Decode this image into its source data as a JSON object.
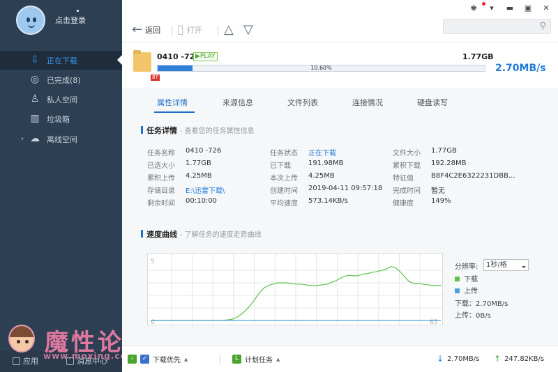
{
  "user": {
    "login_label": "点击登录"
  },
  "sidebar": {
    "items": [
      {
        "label": "正在下载",
        "icon": "download-icon"
      },
      {
        "label": "已完成(8)",
        "icon": "check-circle-icon"
      },
      {
        "label": "私人空间",
        "icon": "user-icon"
      },
      {
        "label": "垃圾箱",
        "icon": "trash-icon"
      },
      {
        "label": "离线空间",
        "icon": "cloud-icon"
      }
    ],
    "apps_label": "应用",
    "messages_label": "消息中心"
  },
  "watermark": {
    "text": "魔性论坛",
    "url": "www.moxing.com"
  },
  "toolbar": {
    "back_label": "返回",
    "open_label": "打开"
  },
  "task": {
    "name": "0410 -726",
    "play_label": "PLAY",
    "type_tag": "BT",
    "size": "1.77GB",
    "progress_text": "10.60%",
    "progress": 0.106,
    "speed": "2.70MB/s"
  },
  "tabs": [
    {
      "label": "属性详情"
    },
    {
      "label": "来源信息"
    },
    {
      "label": "文件列表"
    },
    {
      "label": "连接情况"
    },
    {
      "label": "硬盘读写"
    }
  ],
  "details": {
    "title": "任务详情",
    "subtitle": "- 查看您的任务属性信息",
    "fields": [
      {
        "k": "任务名称",
        "v": "0410 -726"
      },
      {
        "k": "已选大小",
        "v": "1.77GB"
      },
      {
        "k": "累积上传",
        "v": "4.25MB"
      },
      {
        "k": "存储目录",
        "v": "E:\\迅雷下载\\"
      },
      {
        "k": "剩余时间",
        "v": "00:10:00"
      },
      {
        "k": "任务状态",
        "v": "正在下载"
      },
      {
        "k": "已下载",
        "v": "191.98MB"
      },
      {
        "k": "本次上传",
        "v": "4.25MB"
      },
      {
        "k": "创建时间",
        "v": "2019-04-11 09:57:18"
      },
      {
        "k": "平均速度",
        "v": "573.14KB/s"
      },
      {
        "k": "文件大小",
        "v": "1.77GB"
      },
      {
        "k": "累积下载",
        "v": "192.28MB"
      },
      {
        "k": "特征值",
        "v": "B8F4C2E6322231DBB..."
      },
      {
        "k": "完成时间",
        "v": "暂无"
      },
      {
        "k": "健康度",
        "v": "149%"
      }
    ]
  },
  "speed_section": {
    "title": "速度曲线",
    "subtitle": "- 了解任务的速度走势曲线",
    "rate_label": "分辨率:",
    "rate_value": "1秒/格",
    "download_legend": "下载",
    "upload_legend": "上传",
    "download_speed_text": "下载：2.70MB/s",
    "upload_speed_text": "上传：0B/s",
    "download_color": "#5ec24a",
    "upload_color": "#4aa3df"
  },
  "chart_data": {
    "type": "line",
    "ylim": [
      0,
      5
    ],
    "y_tick_labels": [
      "5",
      "0"
    ],
    "x_end_label": "65",
    "series": [
      {
        "name": "下载",
        "values": [
          0,
          0,
          0,
          0,
          0,
          0,
          0,
          0,
          0,
          0,
          0,
          0,
          0,
          0,
          0,
          0,
          0,
          0.05,
          0.1,
          0.25,
          0.5,
          0.8,
          1.2,
          1.7,
          2.2,
          2.6,
          2.8,
          2.9,
          3.0,
          3.0,
          3.0,
          2.95,
          2.9,
          2.9,
          2.85,
          2.8,
          2.75,
          2.8,
          2.85,
          2.9,
          3.05,
          3.2,
          3.4,
          3.55,
          3.6,
          3.55,
          3.6,
          3.7,
          3.75,
          3.85,
          3.9,
          4.0,
          4.1,
          4.3,
          4.2,
          3.9,
          3.5,
          3.1,
          2.95,
          2.95,
          2.9,
          2.85,
          2.8,
          2.8,
          2.8
        ]
      },
      {
        "name": "上传",
        "values": [
          0,
          0,
          0,
          0,
          0,
          0,
          0,
          0,
          0,
          0,
          0,
          0,
          0,
          0,
          0,
          0,
          0,
          0,
          0,
          0,
          0,
          0,
          0,
          0,
          0,
          0,
          0,
          0,
          0,
          0,
          0,
          0,
          0,
          0,
          0,
          0,
          0,
          0,
          0,
          0,
          0,
          0,
          0,
          0,
          0,
          0,
          0,
          0,
          0,
          0,
          0,
          0,
          0,
          0,
          0,
          0,
          0,
          0,
          0,
          0,
          0,
          0,
          0,
          0,
          0
        ]
      }
    ],
    "grid": true
  },
  "statusbar": {
    "priority_label": "下载优先",
    "schedule_label": "计划任务",
    "download_speed": "2.70MB/s",
    "upload_speed": "247.82KB/s"
  }
}
